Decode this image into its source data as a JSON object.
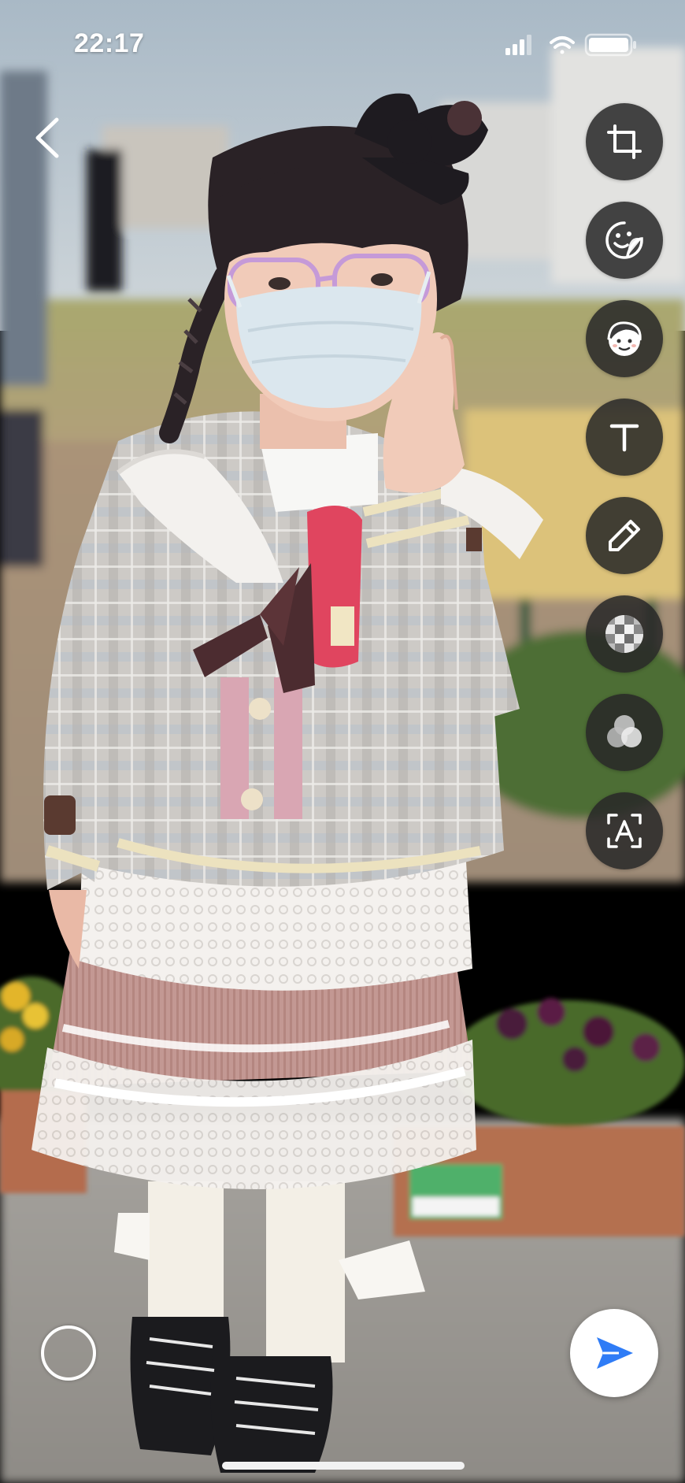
{
  "status_bar": {
    "time": "22:17",
    "icons": [
      "signal-icon",
      "wifi-icon",
      "battery-icon"
    ]
  },
  "navigation": {
    "back_icon": "chevron-left-icon"
  },
  "photo": {
    "subject": "photo-preview"
  },
  "tools": [
    {
      "name": "crop",
      "icon": "crop-icon"
    },
    {
      "name": "sticker",
      "icon": "sticker-icon"
    },
    {
      "name": "avatar",
      "icon": "face-avatar-icon"
    },
    {
      "name": "text",
      "icon": "text-icon"
    },
    {
      "name": "draw",
      "icon": "pencil-icon"
    },
    {
      "name": "mosaic",
      "icon": "mosaic-icon"
    },
    {
      "name": "filter",
      "icon": "filter-circles-icon"
    },
    {
      "name": "text-recognition",
      "icon": "text-scan-icon"
    }
  ],
  "bottom_bar": {
    "toggle_icon": "circle-toggle-icon",
    "send_icon": "send-arrow-icon"
  },
  "colors": {
    "tool_bg": "#2a2a2a",
    "send_arrow": "#2f7cf6",
    "skirt": "#c09690",
    "jacket": "#c8c6c2",
    "accent_pink": "#d9425e"
  }
}
